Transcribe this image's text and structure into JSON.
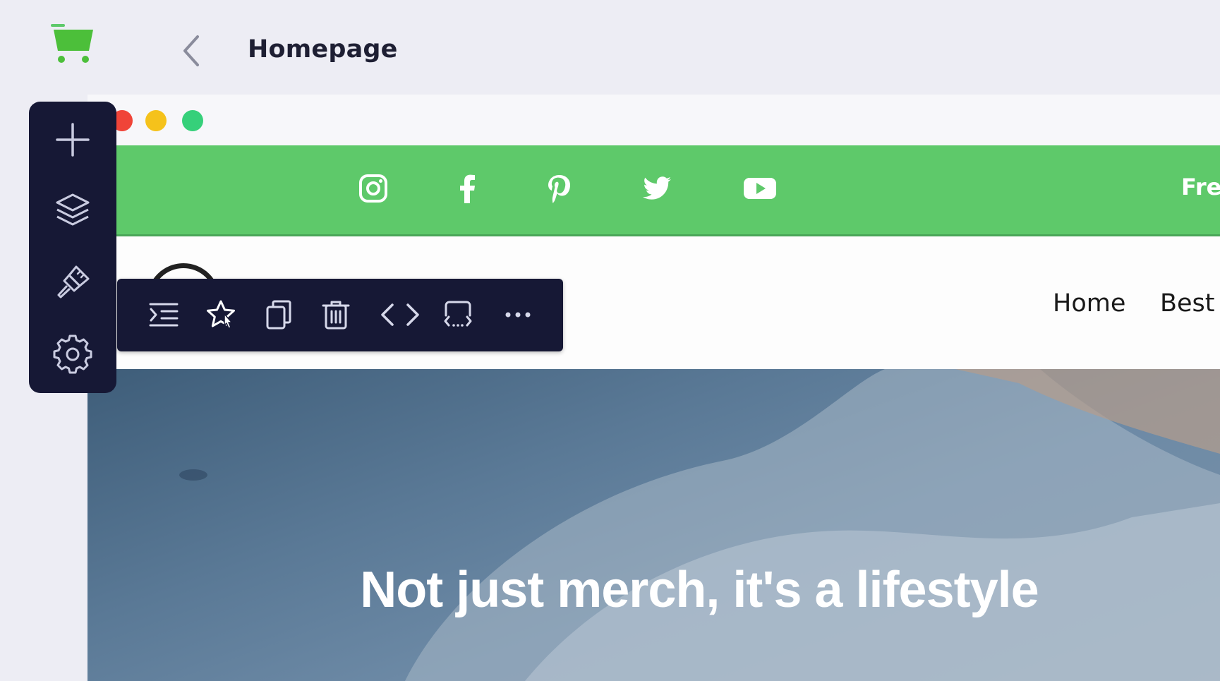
{
  "app": {
    "title": "Homepage"
  },
  "icons": {
    "app_logo": "shopping-cart-icon",
    "back": "chevron-left-icon",
    "sidebar": [
      "plus-icon",
      "layers-icon",
      "brush-icon",
      "gear-icon"
    ],
    "social": [
      "instagram-icon",
      "facebook-icon",
      "pinterest-icon",
      "twitter-icon",
      "youtube-icon"
    ],
    "element_toolbar": [
      "indent-list-icon",
      "star-icon",
      "copy-icon",
      "trash-icon",
      "chevron-left-icon",
      "chevron-right-icon",
      "wrap-code-icon",
      "more-icon"
    ]
  },
  "site": {
    "topbar_text": "Fre",
    "nav": [
      "Home",
      "Best D"
    ],
    "hero_title": "Not just merch, it's a lifestyle"
  },
  "colors": {
    "app_background": "#ededf4",
    "sidebar": "#161835",
    "topbar_green": "#5ec96a",
    "brand_green": "#4cbf3a"
  }
}
